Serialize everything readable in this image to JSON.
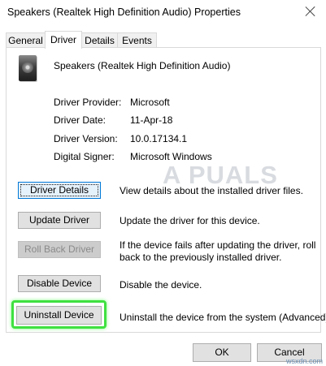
{
  "window": {
    "title": "Speakers (Realtek High Definition Audio) Properties"
  },
  "tabs": [
    {
      "label": "General"
    },
    {
      "label": "Driver"
    },
    {
      "label": "Details"
    },
    {
      "label": "Events"
    }
  ],
  "active_tab": "Driver",
  "device": {
    "name": "Speakers (Realtek High Definition Audio)",
    "icon": "speaker-icon"
  },
  "info": {
    "provider_label": "Driver Provider:",
    "provider_value": "Microsoft",
    "date_label": "Driver Date:",
    "date_value": "11-Apr-18",
    "version_label": "Driver Version:",
    "version_value": "10.0.17134.1",
    "signer_label": "Digital Signer:",
    "signer_value": "Microsoft Windows"
  },
  "actions": {
    "details_label": "Driver Details",
    "details_desc": "View details about the installed driver files.",
    "update_label": "Update Driver",
    "update_desc": "Update the driver for this device.",
    "rollback_label": "Roll Back Driver",
    "rollback_desc_1": "If the device fails after updating the driver, roll",
    "rollback_desc_2": "back to the previously installed driver.",
    "disable_label": "Disable Device",
    "disable_desc": "Disable the device.",
    "uninstall_label": "Uninstall Device",
    "uninstall_desc": "Uninstall the device from the system (Advanced)."
  },
  "footer": {
    "ok_label": "OK",
    "cancel_label": "Cancel"
  },
  "watermark": {
    "text": "A PUALS"
  },
  "corner_mark": {
    "text": "wsxdn.com"
  },
  "colors": {
    "highlight": "#40e040",
    "focus": "#0078d7"
  }
}
